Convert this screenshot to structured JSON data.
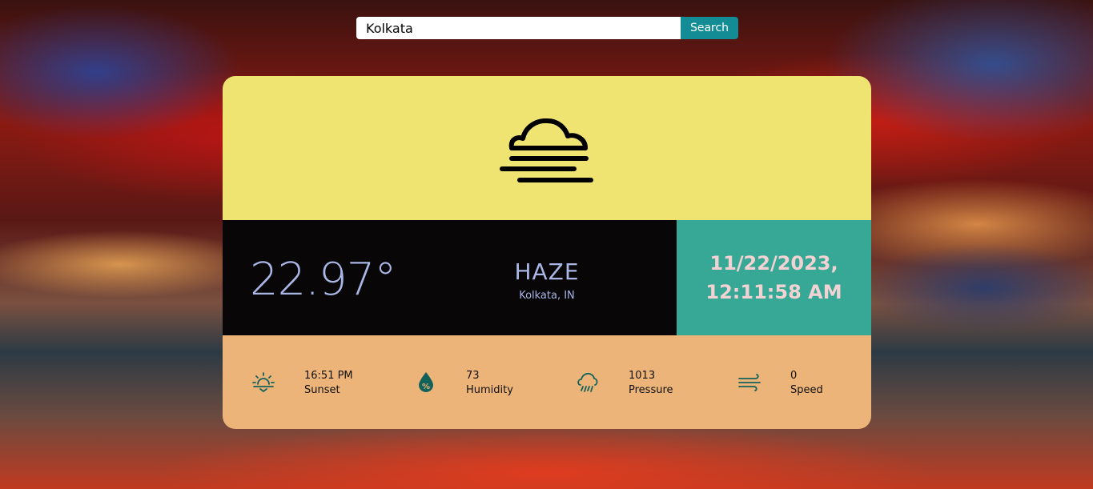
{
  "search": {
    "value": "Kolkata",
    "button_label": "Search"
  },
  "weather": {
    "temperature": "22.97°",
    "condition": "HAZE",
    "location": "Kolkata, IN",
    "icon": "haze-icon"
  },
  "datetime": {
    "date": "11/22/2023,",
    "time": "12:11:58 AM"
  },
  "stats": [
    {
      "value": "16:51 PM",
      "label": "Sunset",
      "icon": "sunset-icon"
    },
    {
      "value": "73",
      "label": "Humidity",
      "icon": "humidity-icon"
    },
    {
      "value": "1013",
      "label": "Pressure",
      "icon": "pressure-icon"
    },
    {
      "value": "0",
      "label": "Speed",
      "icon": "wind-icon"
    }
  ],
  "colors": {
    "icon_panel": "#efe472",
    "temp_panel": "#080606",
    "date_panel": "#37a896",
    "stats_panel": "#edb479",
    "search_button": "#138c96",
    "stat_icon": "#13625a"
  }
}
